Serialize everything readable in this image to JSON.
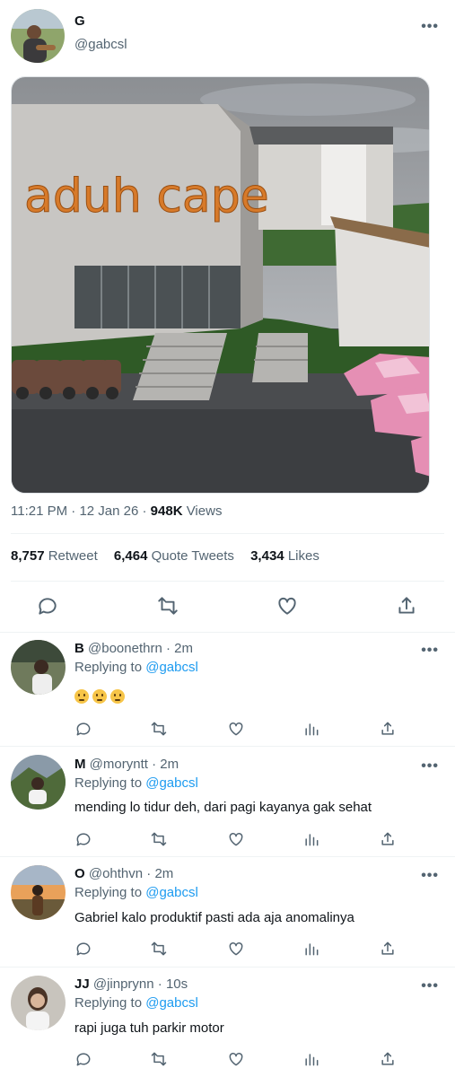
{
  "tweet": {
    "author_name": "G",
    "author_handle": "@gabcsl",
    "more_label": "•••",
    "image_caption": "aduh cape",
    "time": "11:21 PM",
    "sep1": "·",
    "date": "12 Jan 26",
    "sep2": "·",
    "views_count": "948K",
    "views_label": "Views",
    "stats": {
      "retweets_count": "8,757",
      "retweets_label": "Retweet",
      "quotes_count": "6,464",
      "quotes_label": "Quote Tweets",
      "likes_count": "3,434",
      "likes_label": "Likes"
    },
    "actions": [
      "reply-icon",
      "retweet-icon",
      "like-icon",
      "share-icon"
    ]
  },
  "replies": [
    {
      "name": "B",
      "handle": "@boonethrn",
      "sep": "·",
      "time": "2m",
      "replying_prefix": "Replying to",
      "replying_to": "@gabcsl",
      "text": "",
      "emoji_count": 3,
      "more": "•••"
    },
    {
      "name": "M",
      "handle": "@moryntt",
      "sep": "·",
      "time": "2m",
      "replying_prefix": "Replying to",
      "replying_to": "@gabcsl",
      "text": "mending lo tidur deh, dari pagi kayanya gak sehat",
      "more": "•••"
    },
    {
      "name": "O",
      "handle": "@ohthvn",
      "sep": "·",
      "time": "2m",
      "replying_prefix": "Replying to",
      "replying_to": "@gabcsl",
      "text": "Gabriel kalo produktif pasti ada aja anomalinya",
      "more": "•••"
    },
    {
      "name": "JJ",
      "handle": "@jinprynn",
      "sep": "·",
      "time": "10s",
      "replying_prefix": "Replying to",
      "replying_to": "@gabcsl",
      "text": "rapi juga tuh parkir motor",
      "more": "•••"
    }
  ],
  "colors": {
    "link": "#1d9bf0",
    "muted": "#536471",
    "text": "#0f1419",
    "caption_orange": "#d77a2a"
  }
}
